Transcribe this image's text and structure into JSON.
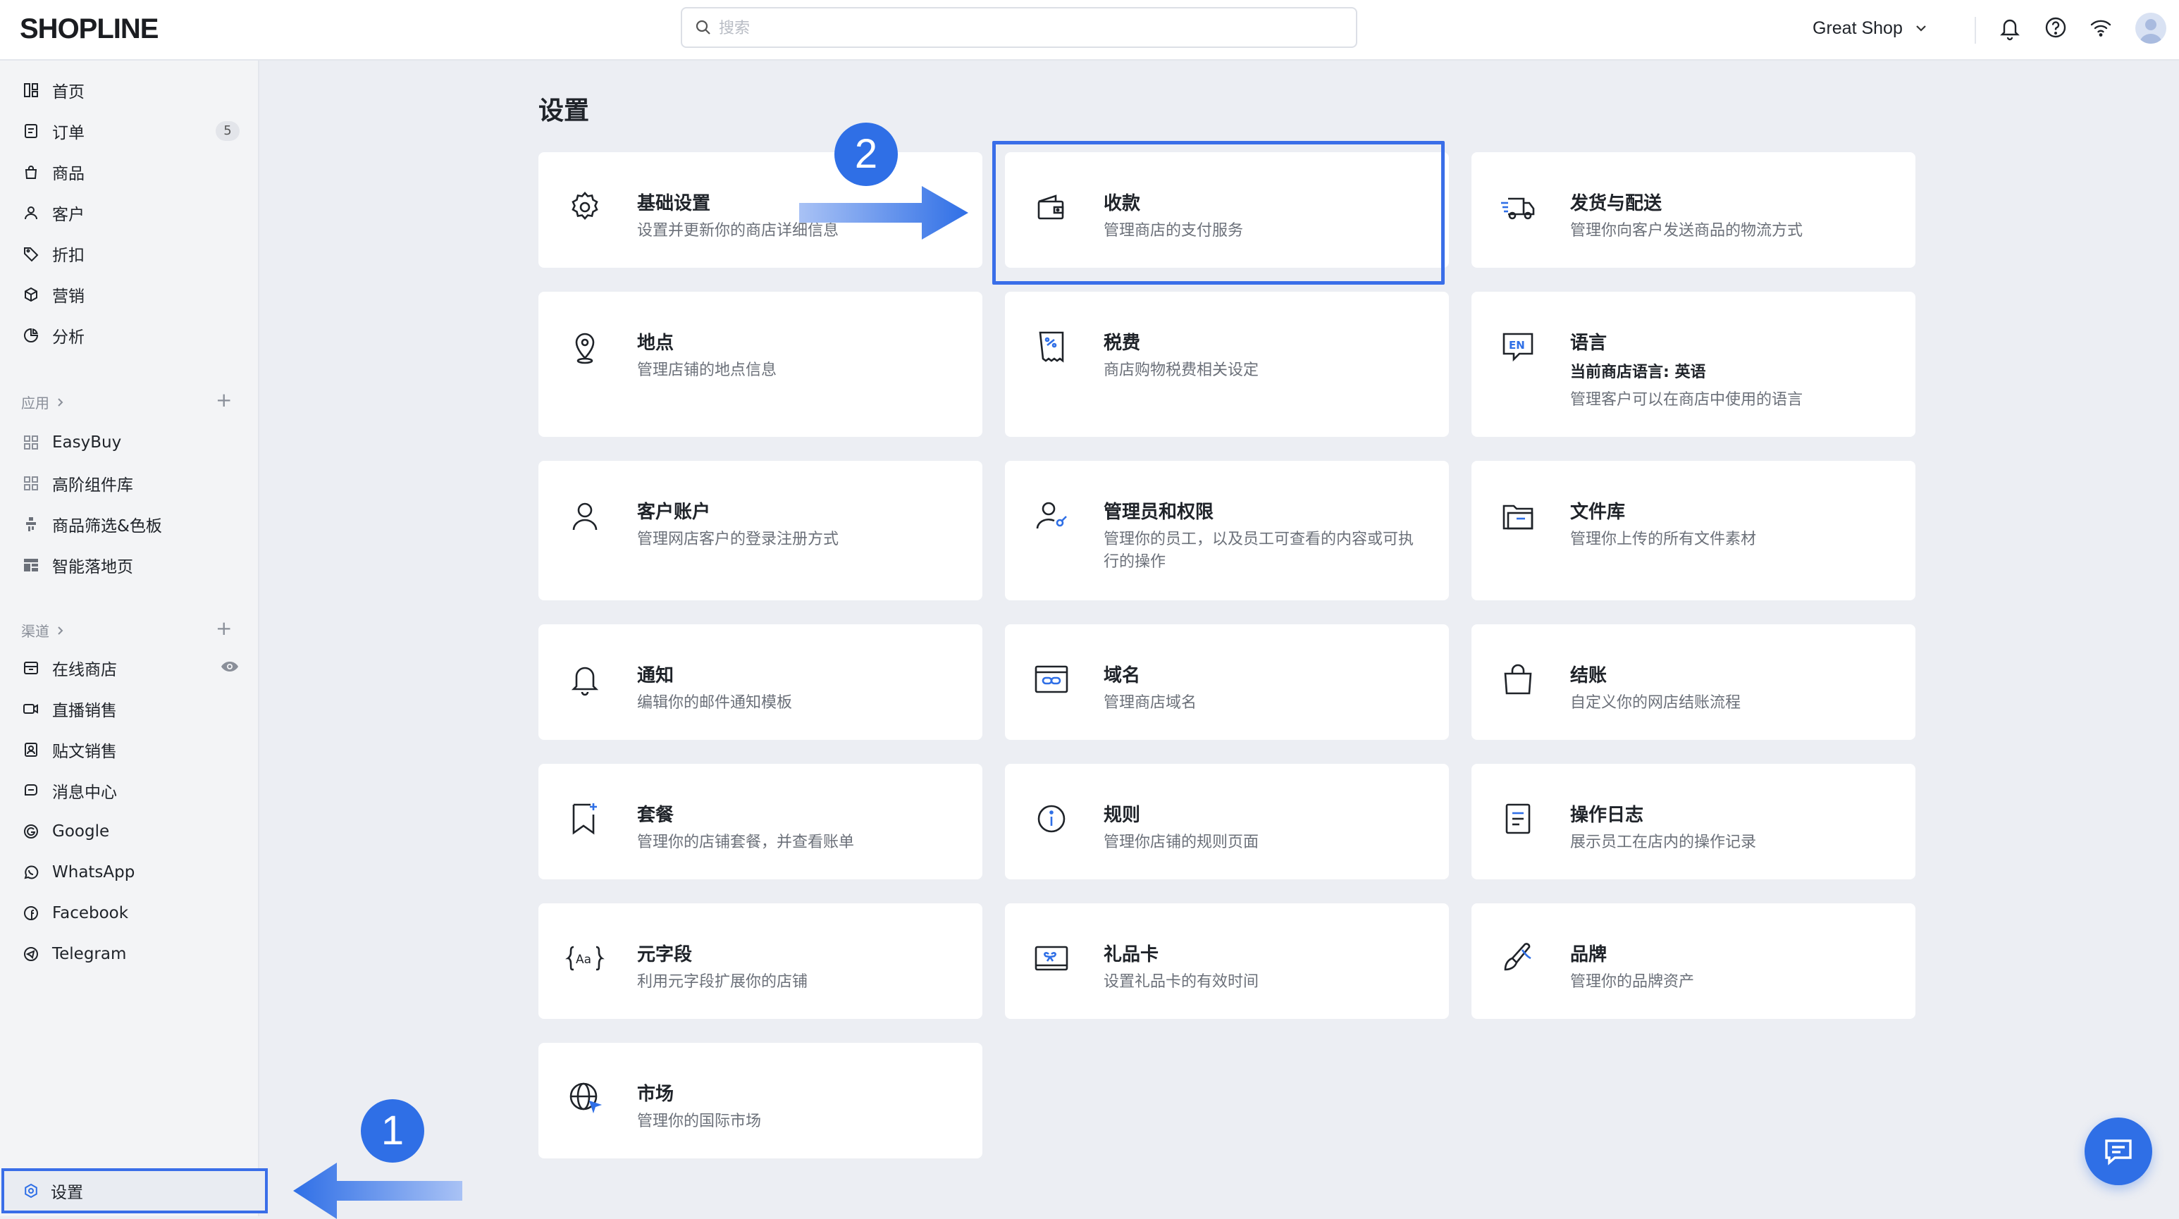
{
  "brand": {
    "logo": "SHOPLINE",
    "accent": "#2f6fe6"
  },
  "search": {
    "placeholder": "搜索"
  },
  "header": {
    "shop_name": "Great Shop"
  },
  "sidebar": {
    "main_items": [
      {
        "label": "首页",
        "icon": "dashboard-icon"
      },
      {
        "label": "订单",
        "icon": "order-icon",
        "badge": "5"
      },
      {
        "label": "商品",
        "icon": "product-bag-icon"
      },
      {
        "label": "客户",
        "icon": "customer-icon"
      },
      {
        "label": "折扣",
        "icon": "tag-icon"
      },
      {
        "label": "营销",
        "icon": "cube-icon"
      },
      {
        "label": "分析",
        "icon": "pie-chart-icon"
      }
    ],
    "apps_label": "应用",
    "apps": [
      {
        "label": "EasyBuy",
        "icon": "app-grid-icon"
      },
      {
        "label": "高阶组件库",
        "icon": "app-grid-icon"
      },
      {
        "label": "商品筛选&色板",
        "icon": "filter-app-icon"
      },
      {
        "label": "智能落地页",
        "icon": "landing-page-icon"
      }
    ],
    "channels_label": "渠道",
    "channels": [
      {
        "label": "在线商店",
        "icon": "storefront-icon"
      },
      {
        "label": "直播销售",
        "icon": "live-video-icon"
      },
      {
        "label": "贴文销售",
        "icon": "post-sale-icon"
      },
      {
        "label": "消息中心",
        "icon": "message-center-icon"
      },
      {
        "label": "Google",
        "icon": "google-icon"
      },
      {
        "label": "WhatsApp",
        "icon": "whatsapp-icon"
      },
      {
        "label": "Facebook",
        "icon": "facebook-icon"
      },
      {
        "label": "Telegram",
        "icon": "telegram-icon"
      }
    ],
    "settings_label": "设置"
  },
  "main": {
    "title": "设置",
    "cards": [
      {
        "title": "基础设置",
        "desc": "设置并更新你的商店详细信息",
        "icon": "gear-icon"
      },
      {
        "title": "收款",
        "desc": "管理商店的支付服务",
        "icon": "wallet-icon"
      },
      {
        "title": "发货与配送",
        "desc": "管理你向客户发送商品的物流方式",
        "icon": "truck-icon"
      },
      {
        "title": "地点",
        "desc": "管理店铺的地点信息",
        "icon": "location-pin-icon"
      },
      {
        "title": "税费",
        "desc": "商店购物税费相关设定",
        "icon": "tax-receipt-icon"
      },
      {
        "title": "语言",
        "subtitle": "当前商店语言: 英语",
        "desc": "管理客户可以在商店中使用的语言",
        "icon": "language-en-icon"
      },
      {
        "title": "客户账户",
        "desc": "管理网店客户的登录注册方式",
        "icon": "customer-account-icon"
      },
      {
        "title": "管理员和权限",
        "desc": "管理你的员工，以及员工可查看的内容或可执行的操作",
        "icon": "admin-permission-icon"
      },
      {
        "title": "文件库",
        "desc": "管理你上传的所有文件素材",
        "icon": "folder-icon"
      },
      {
        "title": "通知",
        "desc": "编辑你的邮件通知模板",
        "icon": "bell-icon"
      },
      {
        "title": "域名",
        "desc": "管理商店域名",
        "icon": "domain-link-icon"
      },
      {
        "title": "结账",
        "desc": "自定义你的网店结账流程",
        "icon": "checkout-bag-icon"
      },
      {
        "title": "套餐",
        "desc": "管理你的店铺套餐，并查看账单",
        "icon": "plan-bookmark-icon"
      },
      {
        "title": "规则",
        "desc": "管理你店铺的规则页面",
        "icon": "info-icon"
      },
      {
        "title": "操作日志",
        "desc": "展示员工在店内的操作记录",
        "icon": "log-document-icon"
      },
      {
        "title": "元字段",
        "desc": "利用元字段扩展你的店铺",
        "icon": "metafield-icon"
      },
      {
        "title": "礼品卡",
        "desc": "设置礼品卡的有效时间",
        "icon": "gift-card-icon"
      },
      {
        "title": "品牌",
        "desc": "管理你的品牌资产",
        "icon": "brand-brush-icon"
      },
      {
        "title": "市场",
        "desc": "管理你的国际市场",
        "icon": "globe-market-icon"
      }
    ]
  },
  "annotations": {
    "step_1": "1",
    "step_2": "2"
  }
}
